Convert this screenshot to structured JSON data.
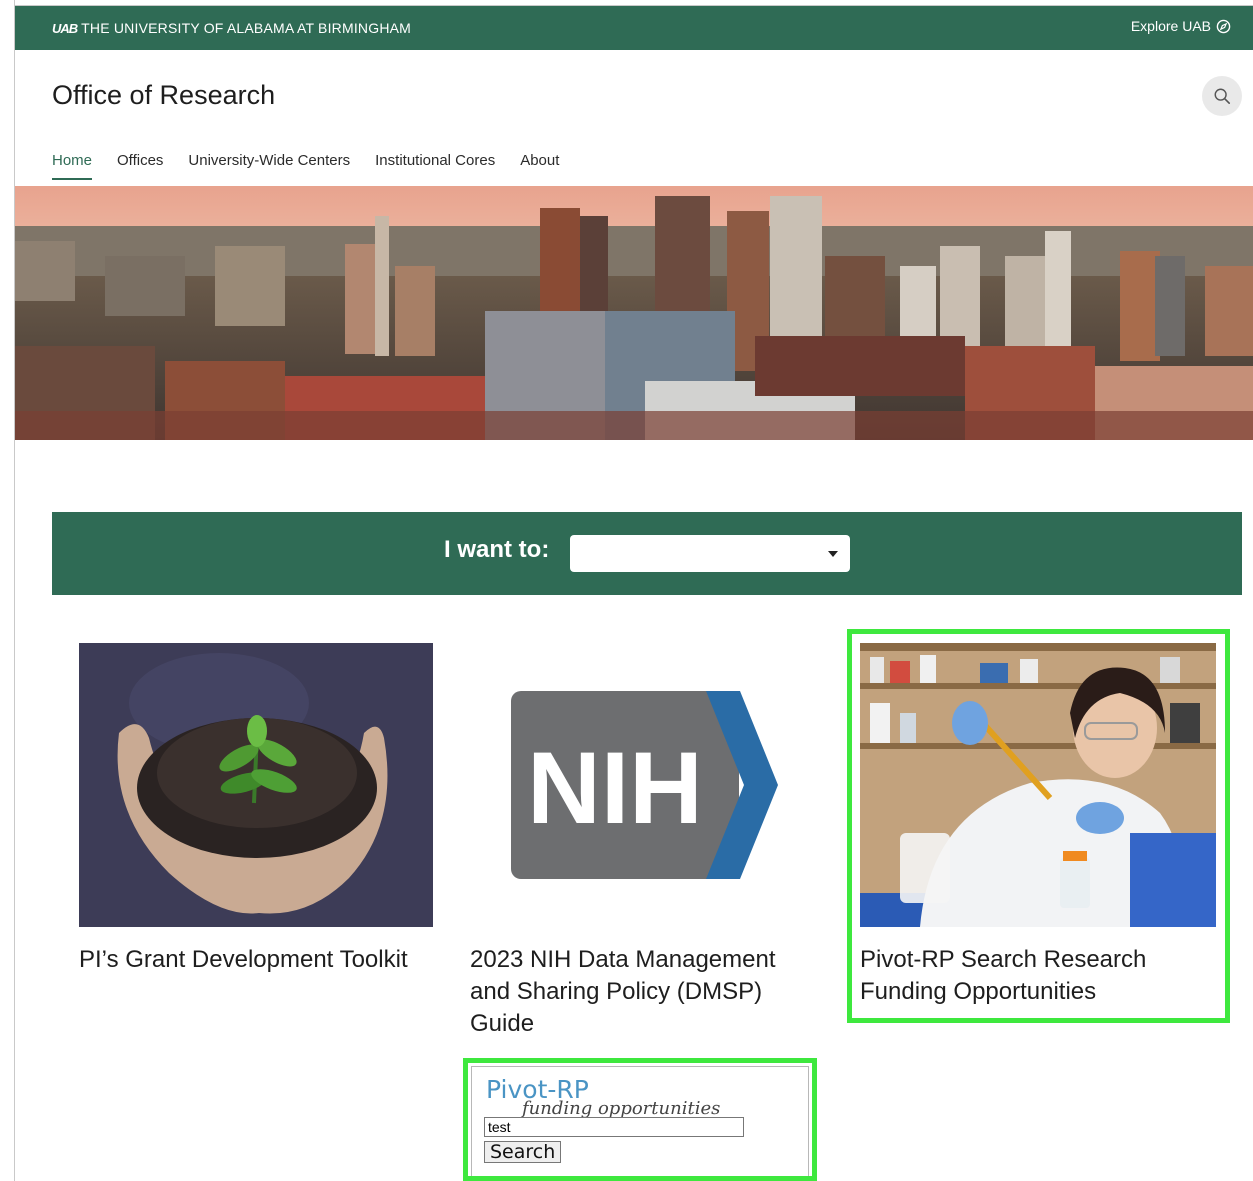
{
  "topbar": {
    "logo": "UAB",
    "university": "THE UNIVERSITY OF ALABAMA AT BIRMINGHAM",
    "explore_label": "Explore UAB",
    "explore_icon": "compass-icon"
  },
  "header": {
    "site_title": "Office of Research",
    "search_icon": "search-icon"
  },
  "nav": {
    "items": [
      {
        "label": "Home",
        "active": true
      },
      {
        "label": "Offices"
      },
      {
        "label": "University-Wide Centers"
      },
      {
        "label": "Institutional Cores"
      },
      {
        "label": "About"
      }
    ]
  },
  "want": {
    "label": "I want to:",
    "selected": ""
  },
  "cards": [
    {
      "title": "PI’s Grant Development Toolkit"
    },
    {
      "title": "2023 NIH Data Management and Sharing Policy (DMSP) Guide",
      "logo_text": "NIH"
    },
    {
      "title": "Pivot-RP Search Research Funding Opportunities"
    }
  ],
  "pivot_widget": {
    "title": "Pivot-RP",
    "subtitle": "funding opportunities",
    "input_value": "test",
    "button_label": "Search"
  },
  "colors": {
    "brand_green": "#2f6b55",
    "highlight": "#3ee83e",
    "nih_gray": "#6d6e70",
    "nih_blue": "#2a6ca6"
  }
}
